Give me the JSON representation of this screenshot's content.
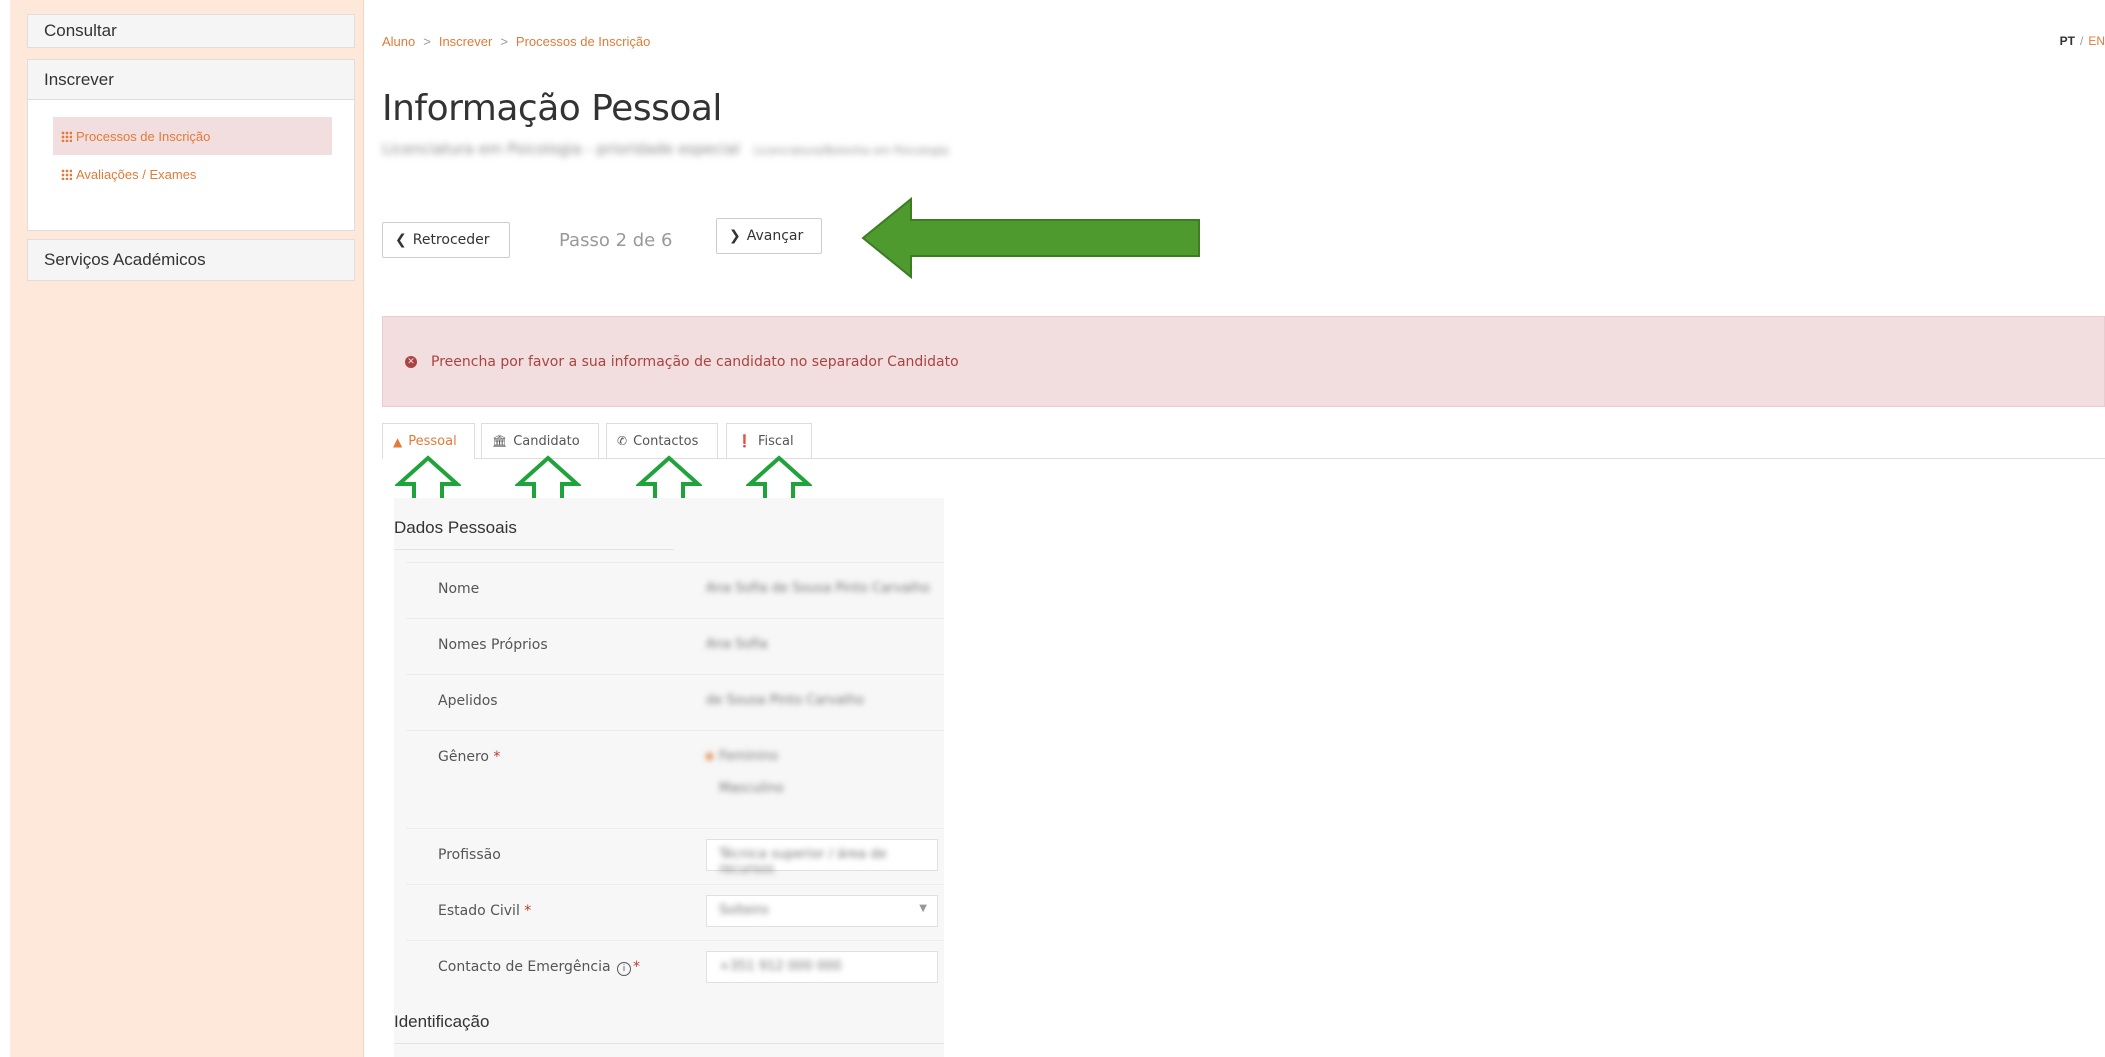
{
  "sidebar": {
    "consultar": "Consultar",
    "inscrever": "Inscrever",
    "links": [
      "Processos de Inscrição",
      "Avaliações / Exames"
    ],
    "servicos": "Serviços Académicos"
  },
  "breadcrumb": [
    "Aluno",
    "Inscrever",
    "Processos de Inscrição"
  ],
  "lang": {
    "pt": "PT",
    "sep": "/",
    "en": "EN"
  },
  "title": "Informação Pessoal",
  "subtitle": {
    "main": "Licenciatura em Psicologia - prioridade especial",
    "small": "Licenciatura/Bolonha em Psicologia"
  },
  "nav": {
    "back": "Retroceder",
    "step": "Passo 2 de 6",
    "next": "Avançar"
  },
  "alert": "Preencha por favor a sua informação de candidato no separador Candidato",
  "tabs": [
    "Pessoal",
    "Candidato",
    "Contactos",
    "Fiscal"
  ],
  "form": {
    "section1": "Dados Pessoais",
    "section2": "Identificação",
    "rows": [
      {
        "label": "Nome",
        "value": "Ana Sofia de Sousa Pinto Carvalho"
      },
      {
        "label": "Nomes Próprios",
        "value": "Ana Sofia"
      },
      {
        "label": "Apelidos",
        "value": "de Sousa Pinto Carvalho"
      },
      {
        "label": "Gênero",
        "req": "*",
        "value": "Feminino",
        "value2": "Masculino"
      },
      {
        "label": "Profissão",
        "value": "Técnica superior / área de recursos"
      },
      {
        "label": "Estado Civil",
        "req": "*",
        "value": "Solteiro"
      },
      {
        "label": "Contacto de Emergência",
        "req": "*",
        "value": "+351 912 000 000"
      }
    ]
  },
  "colors": {
    "accent": "#e07b39",
    "alert_bg": "#f2dede",
    "annotation_green": "#1fa33a",
    "arrow_green": "#4f9a2e"
  }
}
